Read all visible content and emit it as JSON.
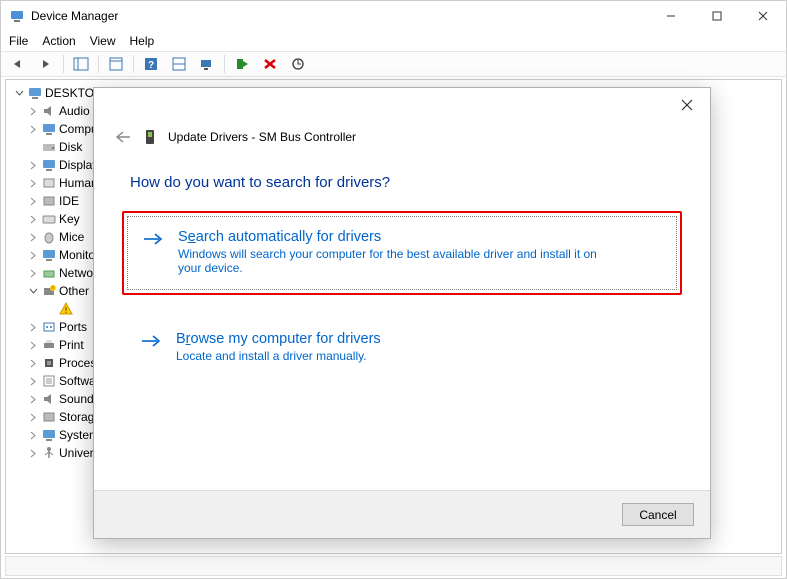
{
  "window": {
    "title": "Device Manager",
    "menus": [
      "File",
      "Action",
      "View",
      "Help"
    ]
  },
  "tree": {
    "root": "DESKTOP",
    "categories": [
      {
        "label": "Audio",
        "expand": "right"
      },
      {
        "label": "Computer",
        "expand": "right"
      },
      {
        "label": "Disk",
        "expand": "none"
      },
      {
        "label": "Display",
        "expand": "right"
      },
      {
        "label": "Human",
        "expand": "right"
      },
      {
        "label": "IDE",
        "expand": "right"
      },
      {
        "label": "Key",
        "expand": "right"
      },
      {
        "label": "Mice",
        "expand": "right"
      },
      {
        "label": "Monitors",
        "expand": "right"
      },
      {
        "label": "Network",
        "expand": "right"
      },
      {
        "label": "Other",
        "expand": "down",
        "children": [
          {
            "label": ""
          }
        ]
      },
      {
        "label": "Ports",
        "expand": "right"
      },
      {
        "label": "Print",
        "expand": "right"
      },
      {
        "label": "Processors",
        "expand": "right"
      },
      {
        "label": "Software",
        "expand": "right"
      },
      {
        "label": "Sound",
        "expand": "right"
      },
      {
        "label": "Storage",
        "expand": "right"
      },
      {
        "label": "System",
        "expand": "right"
      },
      {
        "label": "Universal",
        "expand": "right"
      }
    ]
  },
  "dialog": {
    "title": "Update Drivers - SM Bus Controller",
    "heading": "How do you want to search for drivers?",
    "option1": {
      "title_pre": "S",
      "title_ul": "e",
      "title_post": "arch automatically for drivers",
      "desc": "Windows will search your computer for the best available driver and install it on your device."
    },
    "option2": {
      "title_pre": "B",
      "title_ul": "r",
      "title_post": "owse my computer for drivers",
      "desc": "Locate and install a driver manually."
    },
    "cancel": "Cancel"
  }
}
